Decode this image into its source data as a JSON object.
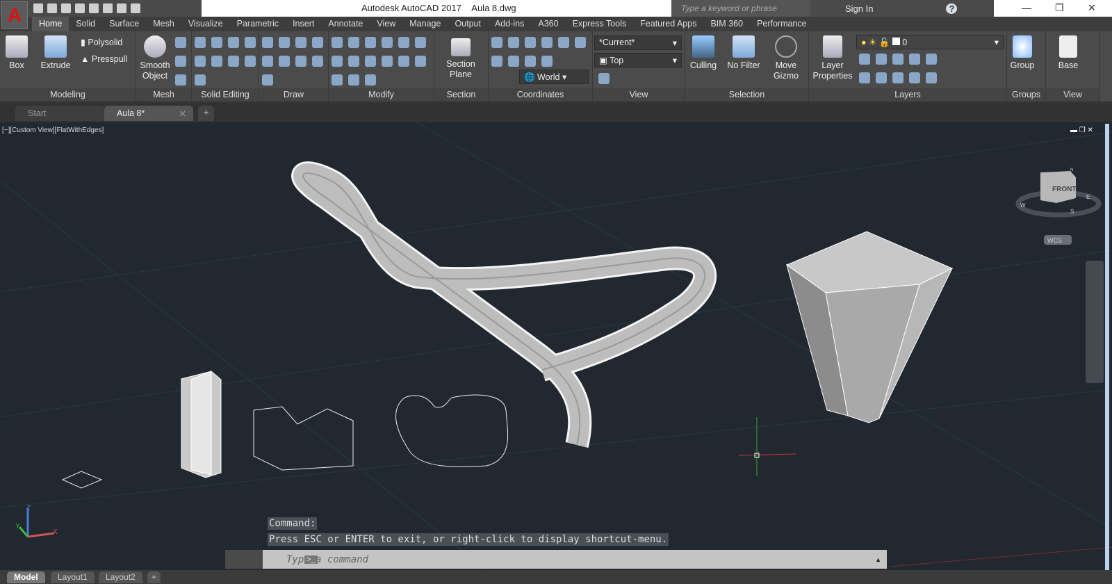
{
  "app": {
    "title": "Autodesk AutoCAD 2017",
    "file": "Aula 8.dwg",
    "logo": "A"
  },
  "search": {
    "placeholder": "Type a keyword or phrase"
  },
  "user": {
    "sign_in": "Sign In"
  },
  "ribbon_tabs": [
    "Home",
    "Solid",
    "Surface",
    "Mesh",
    "Visualize",
    "Parametric",
    "Insert",
    "Annotate",
    "View",
    "Manage",
    "Output",
    "Add-ins",
    "A360",
    "Express Tools",
    "Featured Apps",
    "BIM 360",
    "Performance"
  ],
  "panels": {
    "modeling": {
      "title": "Modeling",
      "box": "Box",
      "extrude": "Extrude",
      "polysolid": "Polysolid",
      "presspull": "Presspull"
    },
    "mesh": {
      "title": "Mesh",
      "smooth1": "Smooth",
      "smooth2": "Object"
    },
    "solid_editing": {
      "title": "Solid Editing"
    },
    "draw": {
      "title": "Draw"
    },
    "modify": {
      "title": "Modify"
    },
    "section": {
      "title": "Section",
      "plane1": "Section",
      "plane2": "Plane"
    },
    "coordinates": {
      "title": "Coordinates",
      "ucs": "World"
    },
    "view": {
      "title": "View",
      "visual_style": "*Current*",
      "view": "Top"
    },
    "selection": {
      "title": "Selection",
      "culling": "Culling",
      "filter": "No Filter",
      "gizmo1": "Move",
      "gizmo2": "Gizmo"
    },
    "layers": {
      "title": "Layers",
      "props1": "Layer",
      "props2": "Properties",
      "current_layer": "0"
    },
    "groups": {
      "title": "Groups",
      "group": "Group"
    },
    "view2": {
      "title": "View",
      "base": "Base"
    }
  },
  "doc_tabs": [
    "Start",
    "Aula 8*"
  ],
  "viewport": {
    "label": "[−][Custom View][FlatWithEdges]",
    "viewcube": "FRONT",
    "wcs": "WCS",
    "compass": [
      "N",
      "E",
      "S",
      "W"
    ],
    "ucs": {
      "x": "X",
      "y": "Y",
      "z": "Z"
    }
  },
  "command": {
    "history": [
      "Command:",
      "Press ESC or ENTER to exit, or right-click to display shortcut-menu."
    ],
    "placeholder": "Type a command"
  },
  "layout_tabs": [
    "Model",
    "Layout1",
    "Layout2"
  ]
}
